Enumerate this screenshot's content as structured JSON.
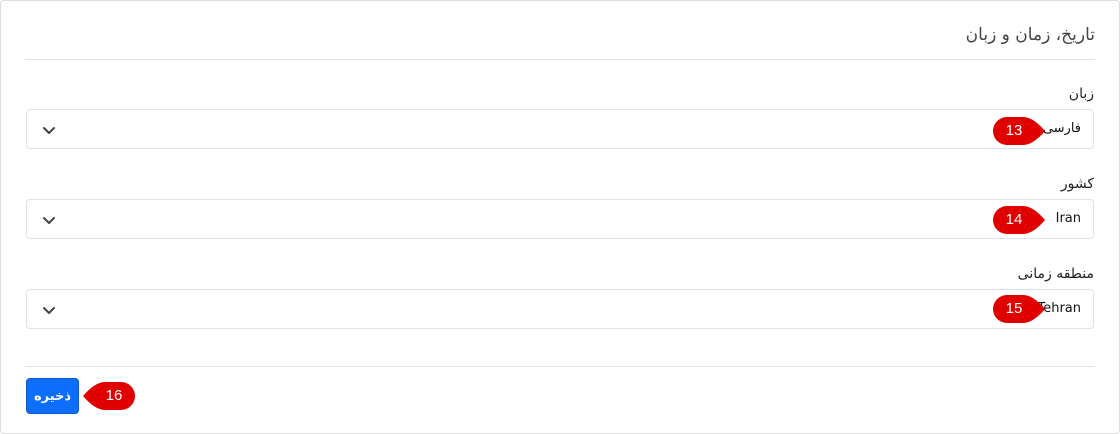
{
  "section": {
    "title": "تاریخ، زمان و زبان"
  },
  "fields": [
    {
      "label": "زبان",
      "value": "فارسی",
      "marker": "13"
    },
    {
      "label": "کشور",
      "value": "Iran",
      "marker": "14"
    },
    {
      "label": "منطقه زمانی",
      "value": "Tehran",
      "marker": "15"
    }
  ],
  "save": {
    "label": "ذخیره",
    "marker": "16"
  },
  "colors": {
    "accent": "#0d6efd",
    "marker": "#e00000"
  },
  "icons": {
    "dropdown": "chevron-down-icon"
  }
}
